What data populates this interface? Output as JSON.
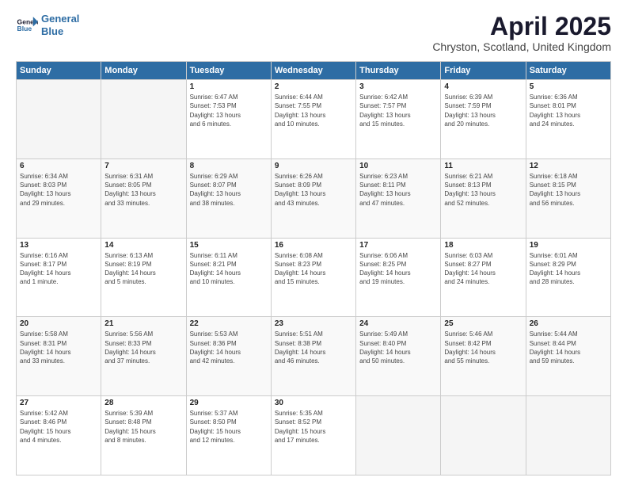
{
  "logo": {
    "line1": "General",
    "line2": "Blue"
  },
  "title": "April 2025",
  "subtitle": "Chryston, Scotland, United Kingdom",
  "days_header": [
    "Sunday",
    "Monday",
    "Tuesday",
    "Wednesday",
    "Thursday",
    "Friday",
    "Saturday"
  ],
  "weeks": [
    [
      {
        "num": "",
        "info": ""
      },
      {
        "num": "",
        "info": ""
      },
      {
        "num": "1",
        "info": "Sunrise: 6:47 AM\nSunset: 7:53 PM\nDaylight: 13 hours\nand 6 minutes."
      },
      {
        "num": "2",
        "info": "Sunrise: 6:44 AM\nSunset: 7:55 PM\nDaylight: 13 hours\nand 10 minutes."
      },
      {
        "num": "3",
        "info": "Sunrise: 6:42 AM\nSunset: 7:57 PM\nDaylight: 13 hours\nand 15 minutes."
      },
      {
        "num": "4",
        "info": "Sunrise: 6:39 AM\nSunset: 7:59 PM\nDaylight: 13 hours\nand 20 minutes."
      },
      {
        "num": "5",
        "info": "Sunrise: 6:36 AM\nSunset: 8:01 PM\nDaylight: 13 hours\nand 24 minutes."
      }
    ],
    [
      {
        "num": "6",
        "info": "Sunrise: 6:34 AM\nSunset: 8:03 PM\nDaylight: 13 hours\nand 29 minutes."
      },
      {
        "num": "7",
        "info": "Sunrise: 6:31 AM\nSunset: 8:05 PM\nDaylight: 13 hours\nand 33 minutes."
      },
      {
        "num": "8",
        "info": "Sunrise: 6:29 AM\nSunset: 8:07 PM\nDaylight: 13 hours\nand 38 minutes."
      },
      {
        "num": "9",
        "info": "Sunrise: 6:26 AM\nSunset: 8:09 PM\nDaylight: 13 hours\nand 43 minutes."
      },
      {
        "num": "10",
        "info": "Sunrise: 6:23 AM\nSunset: 8:11 PM\nDaylight: 13 hours\nand 47 minutes."
      },
      {
        "num": "11",
        "info": "Sunrise: 6:21 AM\nSunset: 8:13 PM\nDaylight: 13 hours\nand 52 minutes."
      },
      {
        "num": "12",
        "info": "Sunrise: 6:18 AM\nSunset: 8:15 PM\nDaylight: 13 hours\nand 56 minutes."
      }
    ],
    [
      {
        "num": "13",
        "info": "Sunrise: 6:16 AM\nSunset: 8:17 PM\nDaylight: 14 hours\nand 1 minute."
      },
      {
        "num": "14",
        "info": "Sunrise: 6:13 AM\nSunset: 8:19 PM\nDaylight: 14 hours\nand 5 minutes."
      },
      {
        "num": "15",
        "info": "Sunrise: 6:11 AM\nSunset: 8:21 PM\nDaylight: 14 hours\nand 10 minutes."
      },
      {
        "num": "16",
        "info": "Sunrise: 6:08 AM\nSunset: 8:23 PM\nDaylight: 14 hours\nand 15 minutes."
      },
      {
        "num": "17",
        "info": "Sunrise: 6:06 AM\nSunset: 8:25 PM\nDaylight: 14 hours\nand 19 minutes."
      },
      {
        "num": "18",
        "info": "Sunrise: 6:03 AM\nSunset: 8:27 PM\nDaylight: 14 hours\nand 24 minutes."
      },
      {
        "num": "19",
        "info": "Sunrise: 6:01 AM\nSunset: 8:29 PM\nDaylight: 14 hours\nand 28 minutes."
      }
    ],
    [
      {
        "num": "20",
        "info": "Sunrise: 5:58 AM\nSunset: 8:31 PM\nDaylight: 14 hours\nand 33 minutes."
      },
      {
        "num": "21",
        "info": "Sunrise: 5:56 AM\nSunset: 8:33 PM\nDaylight: 14 hours\nand 37 minutes."
      },
      {
        "num": "22",
        "info": "Sunrise: 5:53 AM\nSunset: 8:36 PM\nDaylight: 14 hours\nand 42 minutes."
      },
      {
        "num": "23",
        "info": "Sunrise: 5:51 AM\nSunset: 8:38 PM\nDaylight: 14 hours\nand 46 minutes."
      },
      {
        "num": "24",
        "info": "Sunrise: 5:49 AM\nSunset: 8:40 PM\nDaylight: 14 hours\nand 50 minutes."
      },
      {
        "num": "25",
        "info": "Sunrise: 5:46 AM\nSunset: 8:42 PM\nDaylight: 14 hours\nand 55 minutes."
      },
      {
        "num": "26",
        "info": "Sunrise: 5:44 AM\nSunset: 8:44 PM\nDaylight: 14 hours\nand 59 minutes."
      }
    ],
    [
      {
        "num": "27",
        "info": "Sunrise: 5:42 AM\nSunset: 8:46 PM\nDaylight: 15 hours\nand 4 minutes."
      },
      {
        "num": "28",
        "info": "Sunrise: 5:39 AM\nSunset: 8:48 PM\nDaylight: 15 hours\nand 8 minutes."
      },
      {
        "num": "29",
        "info": "Sunrise: 5:37 AM\nSunset: 8:50 PM\nDaylight: 15 hours\nand 12 minutes."
      },
      {
        "num": "30",
        "info": "Sunrise: 5:35 AM\nSunset: 8:52 PM\nDaylight: 15 hours\nand 17 minutes."
      },
      {
        "num": "",
        "info": ""
      },
      {
        "num": "",
        "info": ""
      },
      {
        "num": "",
        "info": ""
      }
    ]
  ]
}
